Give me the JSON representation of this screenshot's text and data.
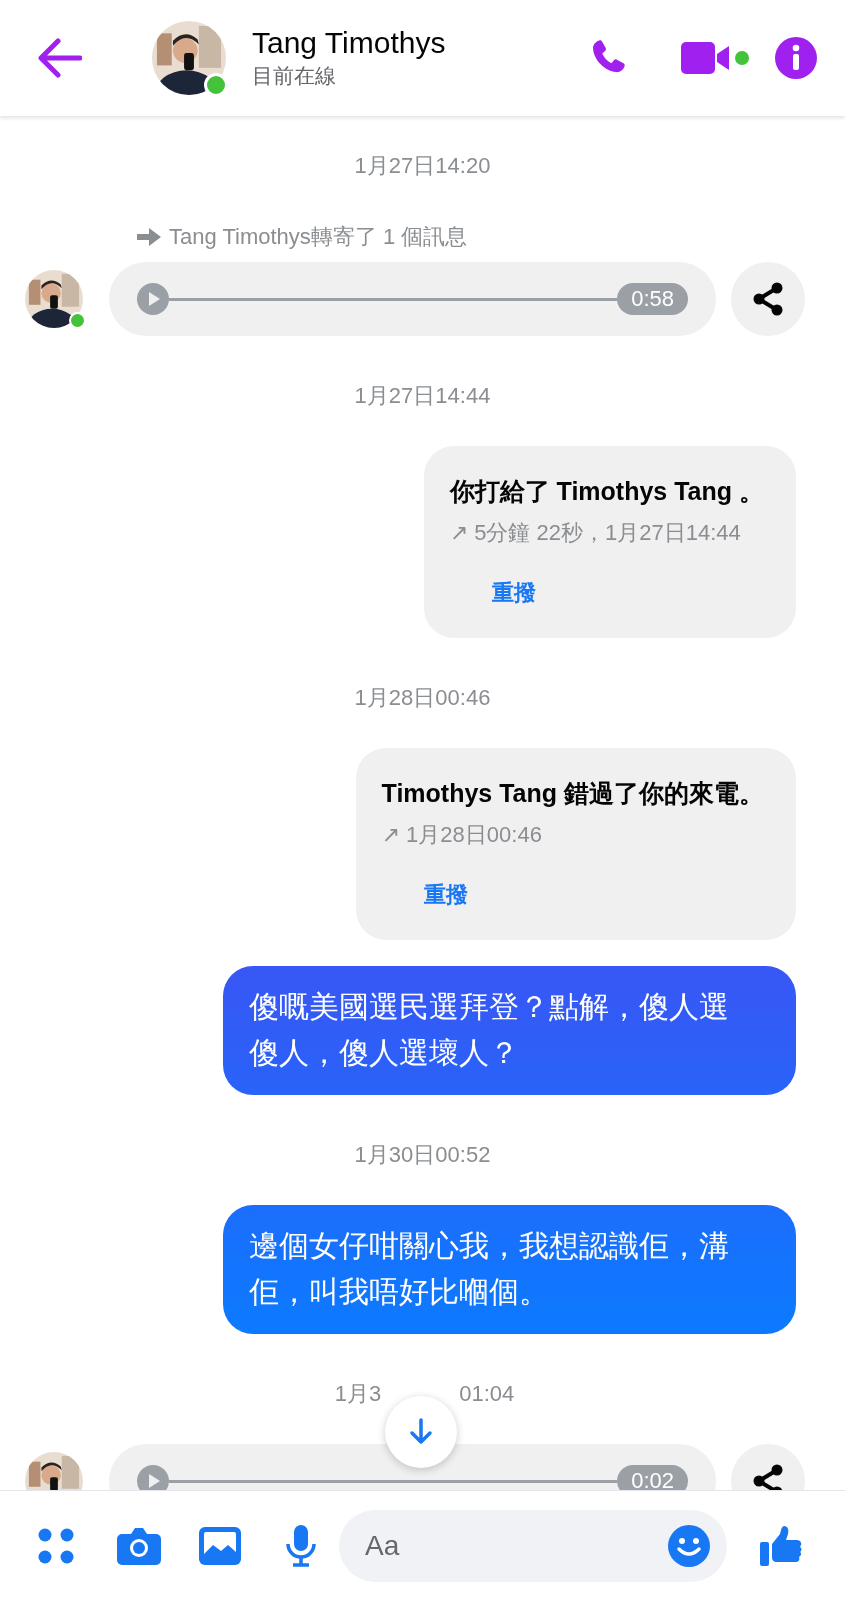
{
  "header": {
    "name": "Tang Timothys",
    "status": "目前在線",
    "online": true,
    "video_online": true
  },
  "messages": [
    {
      "kind": "timestamp",
      "text": "1月27日14:20"
    },
    {
      "kind": "forward_note",
      "text": "Tang Timothys轉寄了 1 個訊息"
    },
    {
      "kind": "audio",
      "duration": "0:58",
      "online": true
    },
    {
      "kind": "timestamp",
      "text": "1月27日14:44"
    },
    {
      "kind": "call",
      "title": "你打給了 Timothys Tang 。",
      "detail": "↗ 5分鐘 22秒，1月27日14:44",
      "action": "重撥"
    },
    {
      "kind": "timestamp",
      "text": "1月28日00:46"
    },
    {
      "kind": "call",
      "title": "Timothys Tang 錯過了你的來電。",
      "detail": "↗ 1月28日00:46",
      "action": "重撥"
    },
    {
      "kind": "text",
      "text": "傻嘅美國選民選拜登？點解，傻人選傻人，傻人選壞人？"
    },
    {
      "kind": "timestamp",
      "text": "1月30日00:52"
    },
    {
      "kind": "text",
      "text": "邊個女仔咁關心我，我想認識佢，溝佢，叫我唔好比嗰個。"
    },
    {
      "kind": "timestamp",
      "text": "1月3",
      "text_after": "01:04"
    },
    {
      "kind": "audio",
      "duration": "0:02"
    }
  ],
  "composer": {
    "placeholder": "Aa"
  }
}
